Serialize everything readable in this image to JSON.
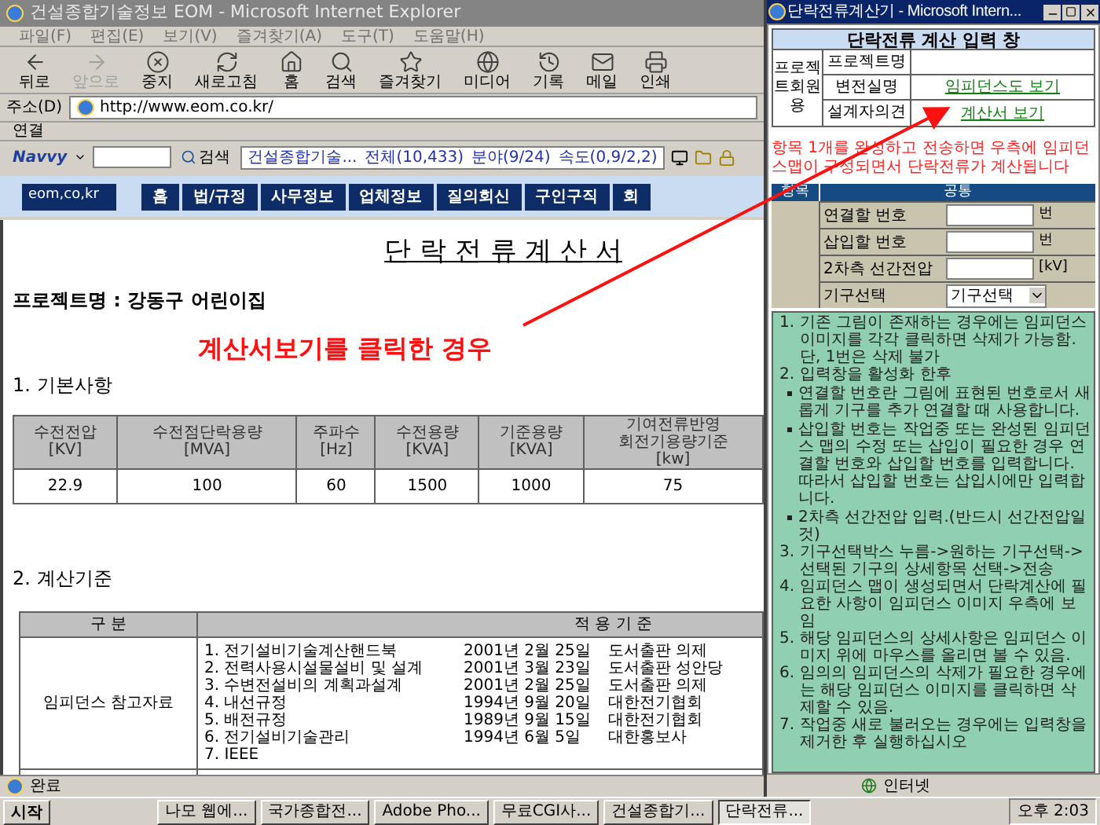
{
  "window": {
    "title": "건설종합기술정보 EOM - Microsoft Internet Explorer"
  },
  "menu": [
    "파일(F)",
    "편집(E)",
    "보기(V)",
    "즐겨찾기(A)",
    "도구(T)",
    "도움말(H)"
  ],
  "toolbar": [
    {
      "kind": "back",
      "label": "뒤로",
      "disabled": false
    },
    {
      "kind": "forward",
      "label": "앞으로",
      "disabled": true
    },
    {
      "kind": "stop",
      "label": "중지",
      "disabled": false
    },
    {
      "kind": "refresh",
      "label": "새로고침",
      "disabled": false
    },
    {
      "kind": "home",
      "label": "홈",
      "disabled": false
    },
    {
      "kind": "search",
      "label": "검색",
      "disabled": false
    },
    {
      "kind": "favorites",
      "label": "즐겨찾기",
      "disabled": false
    },
    {
      "kind": "media",
      "label": "미디어",
      "disabled": false
    },
    {
      "kind": "history",
      "label": "기록",
      "disabled": false
    },
    {
      "kind": "mail",
      "label": "메일",
      "disabled": false
    },
    {
      "kind": "print",
      "label": "인쇄",
      "disabled": false
    }
  ],
  "address": {
    "label": "주소(D)",
    "url": "http://www.eom.co.kr/"
  },
  "links": {
    "label": "연결"
  },
  "navvy": {
    "brand": "Navvy",
    "search_button": "검색",
    "ticker": [
      "건설종합기술...",
      "전체(10,433)",
      "분야(9/24)",
      "속도(0,9/2,2)"
    ]
  },
  "site_nav": {
    "domain": "eom,co,kr",
    "items": [
      "홈",
      "법/규정",
      "사무정보",
      "업체정보",
      "질의회신",
      "구인구직",
      "회"
    ]
  },
  "document": {
    "title": "단 락 전 류 계 산 서",
    "project": "프로젝트명 : 강동구 어린이집",
    "section_1": "1. 기본사항",
    "basic_table": {
      "columns": [
        [
          "수전전압",
          "[KV]"
        ],
        [
          "수전점단락용량",
          "[MVA]"
        ],
        [
          "주파수",
          "[Hz]"
        ],
        [
          "수전용량",
          "[KVA]"
        ],
        [
          "기준용량",
          "[KVA]"
        ],
        [
          "기여전류반영",
          "회전기용량기준",
          "[kw]"
        ]
      ],
      "row": [
        "22.9",
        "100",
        "60",
        "1500",
        "1000",
        "75"
      ]
    },
    "section_2": "2. 계산기준",
    "criteria_table": {
      "columns": [
        "구 분",
        "적 용 기 준"
      ],
      "category": "임피던스 참고자료",
      "references": [
        {
          "name": "1. 전기설비기술계산핸드북",
          "date": "2001년 2월 25일",
          "publisher": "도서출판 의제"
        },
        {
          "name": "2. 전력사용시설물설비 및 설계",
          "date": "2001년 3월 23일",
          "publisher": "도서출판 성안당"
        },
        {
          "name": "3. 수변전설비의 계획과설계",
          "date": "2001년 2월 25일",
          "publisher": "도서출판 의제"
        },
        {
          "name": "4. 내선규정",
          "date": "1994년 9월 20일",
          "publisher": "대한전기협회"
        },
        {
          "name": "5. 배전규정",
          "date": "1989년 9월 15일",
          "publisher": "대한전기협회"
        },
        {
          "name": "6. 전기설비기술관리",
          "date": "1994년 6월 5일",
          "publisher": "대한홍보사"
        },
        {
          "name": "7. IEEE"
        }
      ]
    }
  },
  "annotation": "계산서보기를 클릭한 경우",
  "status_bar": {
    "text": "완료"
  },
  "popup": {
    "title": "단락전류계산기 - Microsoft Intern...",
    "form_title": "단락전류 계산 입력 창",
    "side_label": "프로젝트회원용",
    "rows": [
      {
        "label": "프로젝트명"
      },
      {
        "label": "변전실명",
        "link": "임피던스도 보기"
      },
      {
        "label": "설계자의견",
        "link": "계산서 보기"
      }
    ],
    "notice": "항목 1개를 완성하고 전송하면 우측에 임피던스맵이 구성되면서 단락전류가 계산됩니다",
    "input_header": [
      "항목",
      "공통"
    ],
    "inputs": [
      {
        "kind": "input",
        "label": "연결할 번호",
        "unit": "번"
      },
      {
        "kind": "input",
        "label": "삽입할 번호",
        "unit": "번"
      },
      {
        "kind": "input",
        "label": "2차측 선간전압",
        "unit": "[kV]"
      },
      {
        "kind": "select",
        "label": "기구선택",
        "value": "기구선택"
      }
    ],
    "instructions": [
      {
        "kind": "number",
        "marker": "1.",
        "text": "기존 그림이 존재하는 경우에는 임피던스 이미지를 각각 클릭하면 삭제가 가능함. 단, 1번은 삭제 불가"
      },
      {
        "kind": "number",
        "marker": "2.",
        "text": "입력창을 활성화 한후"
      },
      {
        "kind": "bullet",
        "text": "연결할 번호란 그림에 표현된 번호로서 새롭게 기구를 추가 연결할 때 사용합니다."
      },
      {
        "kind": "bullet",
        "text": "삽입할 번호는 작업중 또는 완성된 임피던스 맵의 수정 또는 삽입이 필요한 경우 연결할 번호와 삽입할 번호를 입력합니다. 따라서 삽입할 번호는 삽입시에만 입력합니다."
      },
      {
        "kind": "bullet",
        "text": "2차측 선간전압 입력.(반드시 선간전압일 것)"
      },
      {
        "kind": "number",
        "marker": "3.",
        "text": "기구선택박스 누름->원하는 기구선택->선택된 기구의 상세항목 선택->전송"
      },
      {
        "kind": "number",
        "marker": "4.",
        "text": "임피던스 맵이 생성되면서 단락계산에 필요한 사항이 임피던스 이미지 우측에 보임"
      },
      {
        "kind": "number",
        "marker": "5.",
        "text": "해당 임피던스의 상세사항은 임피던스 이미지 위에 마우스를 올리면 볼 수 있음."
      },
      {
        "kind": "number",
        "marker": "6.",
        "text": "임의의 임피던스의 삭제가 필요한 경우에는 해당 임피던스 이미지를 클릭하면 삭제할 수 있음."
      },
      {
        "kind": "number",
        "marker": "7.",
        "text": "작업중 새로 불러오는 경우에는 입력창을 제거한 후 실행하십시오"
      }
    ],
    "status": "인터넷"
  },
  "taskbar": {
    "start": "시작",
    "tasks": [
      {
        "label": "나모 웹에...",
        "selected": false
      },
      {
        "label": "국가종합전...",
        "selected": false
      },
      {
        "label": "Adobe Pho...",
        "selected": false
      },
      {
        "label": "무료CGI사...",
        "selected": false
      },
      {
        "label": "건설종합기...",
        "selected": false
      },
      {
        "label": "단락전류...",
        "selected": true
      }
    ],
    "clock": "오후 2:03"
  }
}
